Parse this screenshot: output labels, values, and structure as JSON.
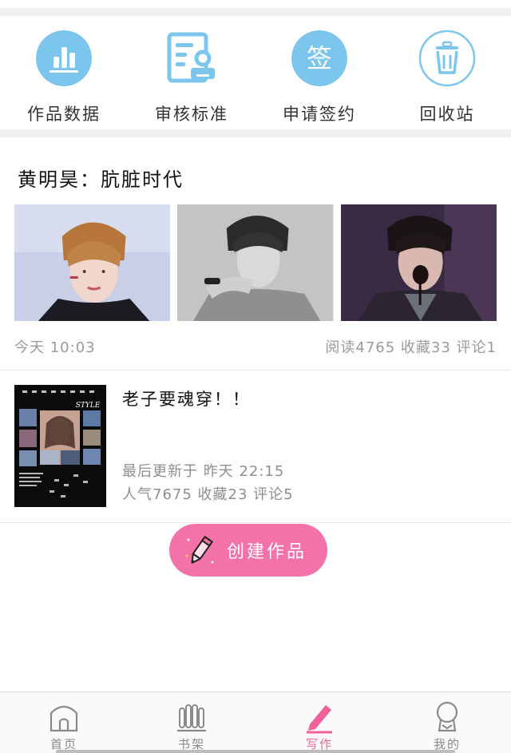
{
  "quick_actions": [
    {
      "label": "作品数据",
      "icon": "bar-chart-icon"
    },
    {
      "label": "审核标准",
      "icon": "review-document-icon"
    },
    {
      "label": "申请签约",
      "icon": "sign-contract-icon",
      "glyph": "签"
    },
    {
      "label": "回收站",
      "icon": "trash-icon"
    }
  ],
  "feature": {
    "title": "黄明昊：肮脏时代",
    "time": "今天  10:03",
    "stats": "阅读4765 收藏33 评论1"
  },
  "work": {
    "title": "老子要魂穿！！",
    "updated": "最后更新于  昨天  22:15",
    "stats": "人气7675 收藏23 评论5",
    "cover_text": "STYLE"
  },
  "create_button": {
    "label": "创建作品"
  },
  "tabbar": [
    {
      "label": "首页",
      "icon": "home-icon"
    },
    {
      "label": "书架",
      "icon": "bookshelf-icon"
    },
    {
      "label": "写作",
      "icon": "pen-icon",
      "active": true
    },
    {
      "label": "我的",
      "icon": "profile-icon"
    }
  ],
  "colors": {
    "accent_pink": "#f472aa",
    "icon_blue": "#7cc6ee",
    "active_tab": "#f0609a"
  }
}
